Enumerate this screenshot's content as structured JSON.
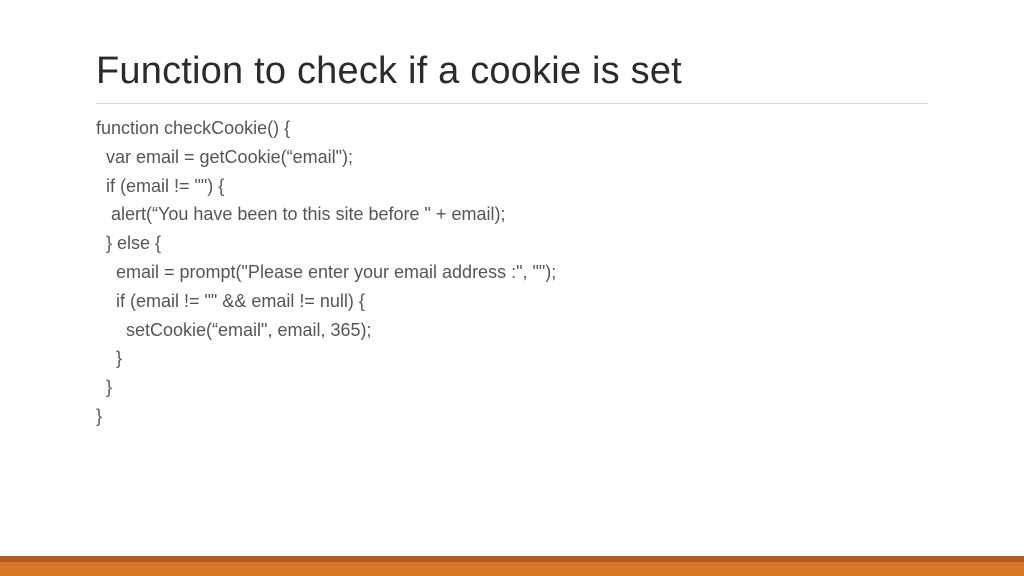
{
  "title": "Function to check if a cookie is set",
  "code": {
    "l1": "function checkCookie() {",
    "l2": "  var email = getCookie(“email\");",
    "l3": "  if (email != \"\") {",
    "l4": "   alert(“You have been to this site before \" + email);",
    "l5": "  } else {",
    "l6": "    email = prompt(\"Please enter your email address :\", \"\");",
    "l7": "    if (email != \"\" && email != null) {",
    "l8": "      setCookie(“email\", email, 365);",
    "l9": "    }",
    "l10": "  }",
    "l11": "}"
  }
}
